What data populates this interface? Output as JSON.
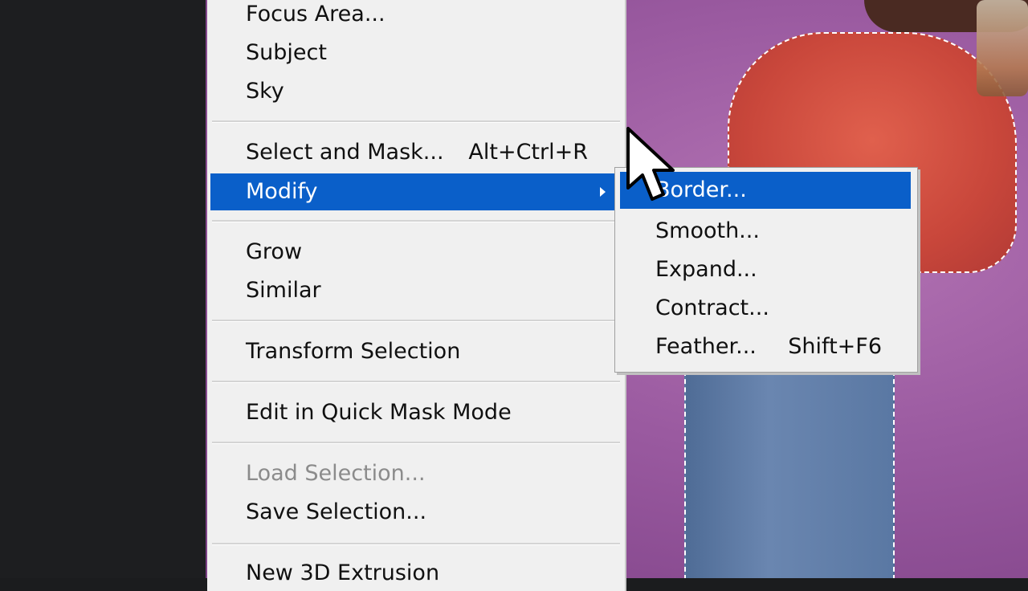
{
  "select_menu": {
    "items_top": [
      {
        "label": "Focus Area..."
      },
      {
        "label": "Subject"
      },
      {
        "label": "Sky"
      }
    ],
    "select_and_mask": {
      "label": "Select and Mask...",
      "shortcut": "Alt+Ctrl+R"
    },
    "modify": {
      "label": "Modify"
    },
    "grow": {
      "label": "Grow"
    },
    "similar": {
      "label": "Similar"
    },
    "transform_selection": {
      "label": "Transform Selection"
    },
    "quick_mask": {
      "label": "Edit in Quick Mask Mode"
    },
    "load_selection": {
      "label": "Load Selection...",
      "disabled": true
    },
    "save_selection": {
      "label": "Save Selection..."
    },
    "new_3d_extrusion": {
      "label": "New 3D Extrusion"
    }
  },
  "modify_submenu": {
    "items": [
      {
        "label": "Border..."
      },
      {
        "label": "Smooth..."
      },
      {
        "label": "Expand..."
      },
      {
        "label": "Contract..."
      },
      {
        "label": "Feather...",
        "shortcut": "Shift+F6"
      }
    ]
  },
  "colors": {
    "highlight": "#0a5fc9",
    "menu_bg": "#f0f0f0",
    "canvas_bg": "#9a5aa0"
  },
  "icons": {
    "pointer": "mouse-pointer-icon",
    "submenu": "submenu-arrow-icon"
  }
}
